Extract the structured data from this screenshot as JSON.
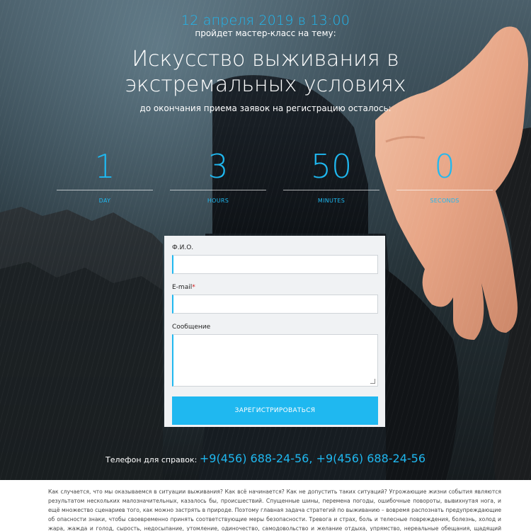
{
  "hero": {
    "date": "12 апреля 2019 в 13:00",
    "subtitle": "пройдет мастер-класс на тему:",
    "title": "Искусство выживания в экстремальных условиях",
    "remaining": "до окончания приема заявок на регистрацию осталось:"
  },
  "countdown": [
    {
      "value": "1",
      "label": "DAY"
    },
    {
      "value": "3",
      "label": "HOURS"
    },
    {
      "value": "50",
      "label": "MINUTES"
    },
    {
      "value": "0",
      "label": "SECONDS"
    }
  ],
  "form": {
    "name_label": "Ф.И.О.",
    "email_label": "E-mail",
    "email_required": "*",
    "message_label": "Сообщение",
    "name_value": "",
    "email_value": "",
    "message_value": "",
    "submit_label": "ЗАРЕГИСТРИРОВАТЬСЯ"
  },
  "contact": {
    "label": "Телефон для справок:",
    "phones": "+9(456) 688-24-56, +9(456) 688-24-56"
  },
  "article": {
    "text": "Как случается, что мы оказываемся в ситуации выживания? Как всё начинается? Как не допустить таких ситуаций? Угрожающие жизни события являются результатом нескольких малозначительных, казалось бы, происшествий. Спущенные шины, перемена погоды, ошибочные повороты, вывихнутая нога, и ещё множество сценариев того, как можно застрять в природе. Поэтому главная задача стратегий по выживанию – вовремя распознать предупреждающие об опасности знаки, чтобы своевременно принять соответствующие меры безопасности. Тревога и страх, боль и телесные повреждения, болезнь, холод и жара, жажда и голод, сырость, недосыпание, утомление, одиночество, самодовольство и желание отдыха, упрямство, нереальные обещания, щадящий режим – всё это противники выживания."
  },
  "colors": {
    "accent": "#1fb8f0",
    "form_bg": "#f0f2f4",
    "required": "#d01a1a"
  }
}
